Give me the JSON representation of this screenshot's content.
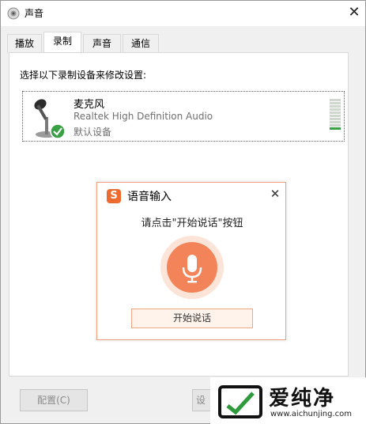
{
  "window": {
    "title": "声音",
    "close_glyph": "✕"
  },
  "tabs": [
    {
      "label": "播放",
      "active": false
    },
    {
      "label": "录制",
      "active": true
    },
    {
      "label": "声音",
      "active": false
    },
    {
      "label": "通信",
      "active": false
    }
  ],
  "panel": {
    "instruction": "选择以下录制设备来修改设置:",
    "devices": [
      {
        "name": "麦克风",
        "driver": "Realtek High Definition Audio",
        "status": "默认设备",
        "icon": "microphone-icon",
        "badge_icon": "green-check-icon",
        "level_lit": 1,
        "level_total": 10
      }
    ]
  },
  "buttons": {
    "configure": "配置(C)",
    "set_default_partial": "设"
  },
  "popup": {
    "logo_letter": "S",
    "title": "语音输入",
    "close_glyph": "✕",
    "prompt": "请点击\"开始说话\"按钮",
    "start_button": "开始说话",
    "mic_icon": "microphone-icon"
  },
  "watermark": {
    "name": "爱纯净",
    "url": "www.aichunjing.com"
  },
  "colors": {
    "accent_orange": "#f3845a",
    "check_green": "#3aa046"
  }
}
